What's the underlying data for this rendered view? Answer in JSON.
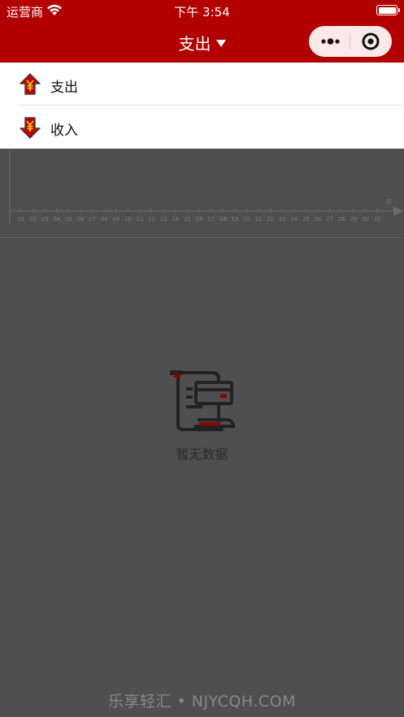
{
  "status_bar": {
    "carrier": "运营商",
    "time": "下午 3:54",
    "battery_level": 1.0
  },
  "nav": {
    "title": "支出",
    "more_icon": "more-dots-icon",
    "close_icon": "target-circle-icon"
  },
  "dropdown": {
    "items": [
      {
        "label": "支出",
        "icon": "yuan-arrow-up-icon"
      },
      {
        "label": "收入",
        "icon": "yuan-arrow-down-icon"
      }
    ]
  },
  "chart_data": {
    "type": "line",
    "x": [
      "01",
      "02",
      "03",
      "04",
      "05",
      "06",
      "07",
      "08",
      "09",
      "10",
      "11",
      "12",
      "13",
      "14",
      "15",
      "16",
      "17",
      "18",
      "19",
      "20",
      "21",
      "22",
      "23",
      "24",
      "25",
      "26",
      "27",
      "28",
      "29",
      "30",
      "31"
    ],
    "y_axis_start_label": "0",
    "series": []
  },
  "empty_state": {
    "text": "暂无数据",
    "icon": "empty-receipt-icon"
  },
  "watermark": "乐享轻汇 • NJYCQH.COM",
  "colors": {
    "brand": "#b20000",
    "overlay": "#4f4f4f",
    "dropdown_bg": "#ffffff"
  }
}
